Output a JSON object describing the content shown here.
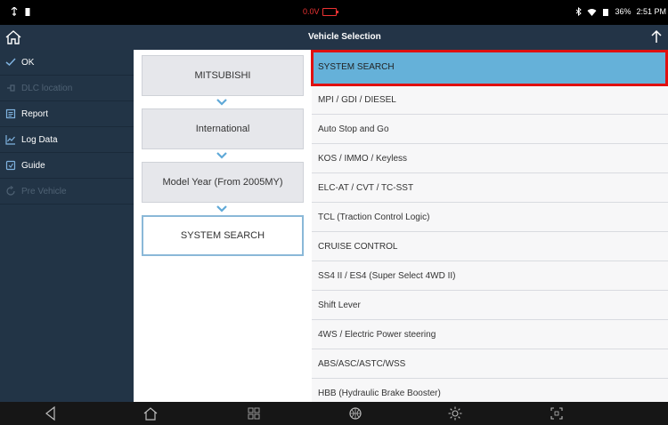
{
  "status_bar": {
    "left_icons": [
      "usb-icon",
      "battery-small-icon"
    ],
    "voltage": "0.0V",
    "right_icons": [
      "bluetooth-icon",
      "wifi-icon",
      "signal-icon"
    ],
    "battery": "36%",
    "time": "2:51 PM"
  },
  "header": {
    "title": "Vehicle Selection"
  },
  "sidebar": {
    "items": [
      {
        "label": "OK",
        "icon": "check-icon",
        "enabled": true
      },
      {
        "label": "DLC location",
        "icon": "dlc-icon",
        "enabled": false
      },
      {
        "label": "Report",
        "icon": "report-icon",
        "enabled": true
      },
      {
        "label": "Log Data",
        "icon": "log-data-icon",
        "enabled": true
      },
      {
        "label": "Guide",
        "icon": "guide-icon",
        "enabled": true
      },
      {
        "label": "Pre Vehicle",
        "icon": "pre-vehicle-icon",
        "enabled": false
      }
    ]
  },
  "path": {
    "items": [
      "MITSUBISHI",
      "International",
      "Model Year (From 2005MY)",
      "SYSTEM SEARCH"
    ]
  },
  "list": {
    "selected_index": 0,
    "items": [
      "SYSTEM SEARCH",
      "MPI / GDI / DIESEL",
      "Auto Stop and Go",
      "KOS / IMMO / Keyless",
      "ELC-AT / CVT / TC-SST",
      "TCL (Traction Control Logic)",
      "CRUISE CONTROL",
      "SS4 II / ES4 (Super Select 4WD II)",
      "Shift Lever",
      "4WS / Electric Power steering",
      "ABS/ASC/ASTC/WSS",
      "HBB (Hydraulic Brake Booster)"
    ]
  },
  "colors": {
    "header_bg": "#233447",
    "selected_row": "#65b1d9",
    "highlight_border": "#e01010"
  },
  "nav_bar": {
    "icons": [
      "back-icon",
      "home-icon",
      "apps-icon",
      "browser-icon",
      "settings-icon",
      "screenshot-icon"
    ]
  }
}
